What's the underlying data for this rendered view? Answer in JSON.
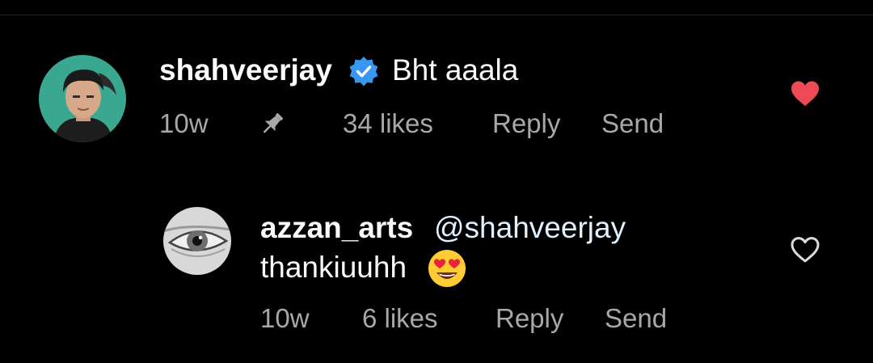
{
  "comment": {
    "username": "shahveerjay",
    "verified_icon": "verified-badge-icon",
    "text": "Bht aaala",
    "time": "10w",
    "pin_icon": "pin-icon",
    "likes": "34 likes",
    "reply_label": "Reply",
    "send_label": "Send",
    "like_icon": "heart-filled-icon",
    "liked": true,
    "like_color": "#ed4956",
    "avatar_bg": "#3aa890"
  },
  "reply": {
    "username": "azzan_arts",
    "mention": "@shahveerjay",
    "text": "thankiuuhh",
    "emoji": "😍",
    "time": "10w",
    "likes": "6 likes",
    "reply_label": "Reply",
    "send_label": "Send",
    "like_icon": "heart-outline-icon",
    "liked": false,
    "mention_color": "#e0f1ff"
  }
}
